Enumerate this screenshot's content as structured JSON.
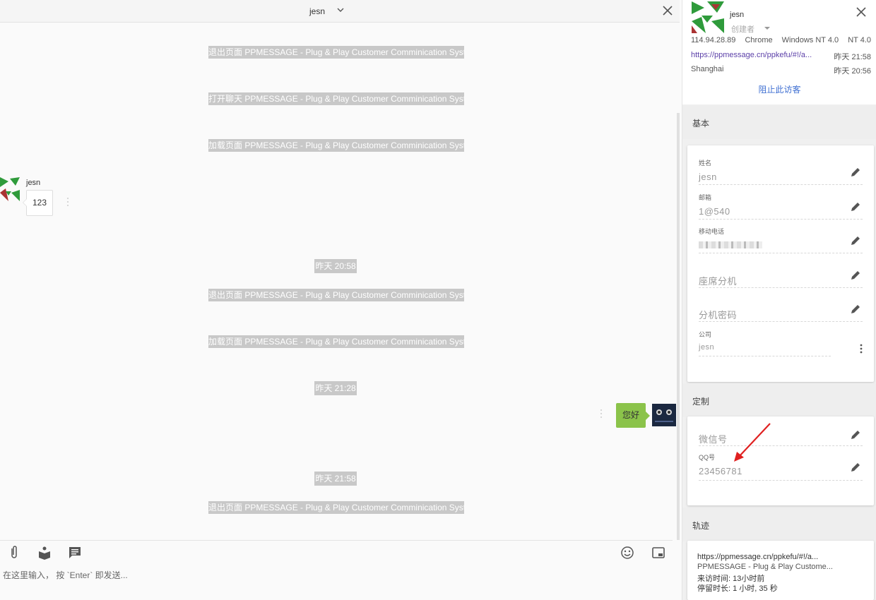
{
  "chat": {
    "title": "jesn",
    "system_messages": [
      "退出页面 PPMESSAGE - Plug & Play Customer Comminication System",
      "打开聊天 PPMESSAGE - Plug & Play Customer Comminication System",
      "加载页面 PPMESSAGE - Plug & Play Customer Comminication System",
      "退出页面 PPMESSAGE - Plug & Play Customer Comminication System",
      "加载页面 PPMESSAGE - Plug & Play Customer Comminication System",
      "退出页面 PPMESSAGE - Plug & Play Customer Comminication System"
    ],
    "timestamps": [
      "昨天 20:58",
      "昨天 21:28",
      "昨天 21:58"
    ],
    "incoming": {
      "sender": "jesn",
      "text": "123"
    },
    "outgoing": {
      "text": "您好"
    },
    "input_placeholder": "在这里输入， 按 `Enter` 即发送..."
  },
  "visitor": {
    "name": "jesn",
    "role": "创建者",
    "ip": "114.94.28.89",
    "browser": "Chrome",
    "os": "Windows NT 4.0",
    "os_short": "NT 4.0",
    "url": "https://ppmessage.cn/ppkefu/#!/a...",
    "url_time": "昨天 21:58",
    "city": "Shanghai",
    "city_time": "昨天 20:56",
    "block_label": "阻止此访客"
  },
  "basic": {
    "heading": "基本",
    "fields": [
      {
        "label": "姓名",
        "value": "jesn"
      },
      {
        "label": "邮箱",
        "value": "1@540"
      },
      {
        "label": "移动电话",
        "value": ""
      },
      {
        "label": "",
        "value": "座席分机"
      },
      {
        "label": "",
        "value": "分机密码"
      },
      {
        "label": "公司",
        "value": "jesn"
      }
    ]
  },
  "custom": {
    "heading": "定制",
    "fields": [
      {
        "label": "",
        "value": "微信号"
      },
      {
        "label": "QQ号",
        "value": "23456781"
      }
    ]
  },
  "track": {
    "heading": "轨迹",
    "url": "https://ppmessage.cn/ppkefu/#!/a...",
    "title": "PPMESSAGE - Plug & Play Custome...",
    "visit_time": "来访时间: 13小时前",
    "stay": "停留时长: 1 小时, 35 秒"
  },
  "colors": {
    "accent_link": "#3f6fd2",
    "outgoing_bubble": "#8bc34a",
    "annotation_arrow": "#e02020"
  }
}
